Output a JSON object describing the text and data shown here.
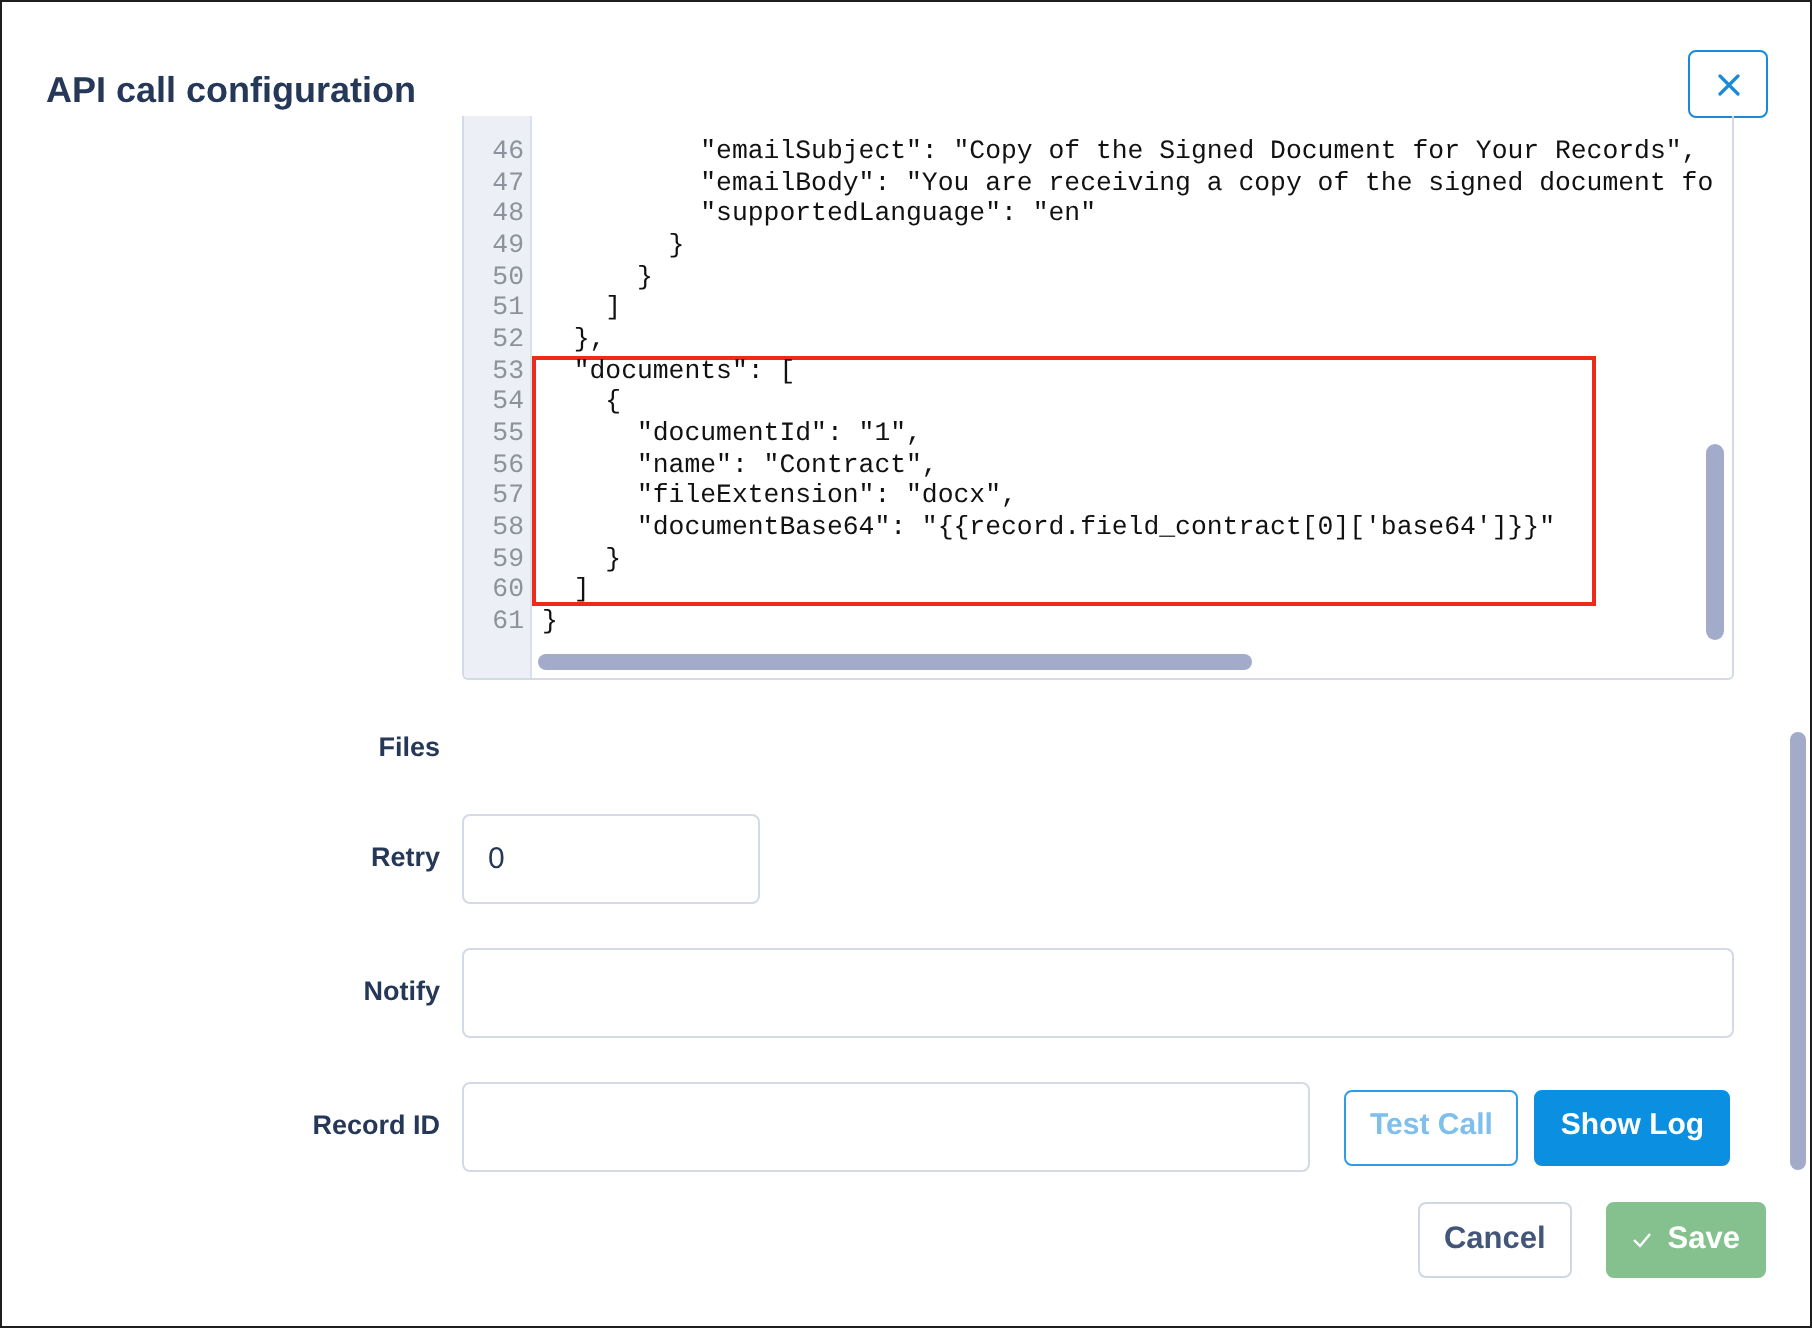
{
  "dialog": {
    "title": "API call configuration"
  },
  "code_editor": {
    "lines": [
      {
        "number": "46",
        "text": "          \"emailSubject\": \"Copy of the Signed Document for Your Records\",",
        "highlighted": false
      },
      {
        "number": "47",
        "text": "          \"emailBody\": \"You are receiving a copy of the signed document fo",
        "highlighted": false
      },
      {
        "number": "48",
        "text": "          \"supportedLanguage\": \"en\"",
        "highlighted": false
      },
      {
        "number": "49",
        "text": "        }",
        "highlighted": false
      },
      {
        "number": "50",
        "text": "      }",
        "highlighted": false
      },
      {
        "number": "51",
        "text": "    ]",
        "highlighted": false
      },
      {
        "number": "52",
        "text": "  },",
        "highlighted": false
      },
      {
        "number": "53",
        "text": "  \"documents\": [",
        "highlighted": true
      },
      {
        "number": "54",
        "text": "    {",
        "highlighted": true
      },
      {
        "number": "55",
        "text": "      \"documentId\": \"1\",",
        "highlighted": true
      },
      {
        "number": "56",
        "text": "      \"name\": \"Contract\",",
        "highlighted": true
      },
      {
        "number": "57",
        "text": "      \"fileExtension\": \"docx\",",
        "highlighted": true
      },
      {
        "number": "58",
        "text": "      \"documentBase64\": \"{{record.field_contract[0]['base64']}}\"",
        "highlighted": true
      },
      {
        "number": "59",
        "text": "    }",
        "highlighted": true
      },
      {
        "number": "60",
        "text": "  ]",
        "highlighted": true
      },
      {
        "number": "61",
        "text": "}",
        "highlighted": false
      }
    ]
  },
  "form": {
    "rows": [
      {
        "kind": "label",
        "label": "Files"
      },
      {
        "kind": "short_input",
        "label": "Retry",
        "value": "0"
      },
      {
        "kind": "input",
        "label": "Notify"
      },
      {
        "kind": "input_with_actions",
        "label": "Record ID",
        "actions": [
          {
            "label": "Test Call",
            "kind": "outline",
            "disabled": true
          },
          {
            "label": "Show Log",
            "kind": "primary",
            "disabled": false
          }
        ]
      }
    ]
  },
  "footer": {
    "buttons": [
      {
        "label": "Cancel",
        "kind": "secondary",
        "disabled": false
      },
      {
        "label": "Save",
        "kind": "success",
        "disabled": true
      }
    ]
  }
}
